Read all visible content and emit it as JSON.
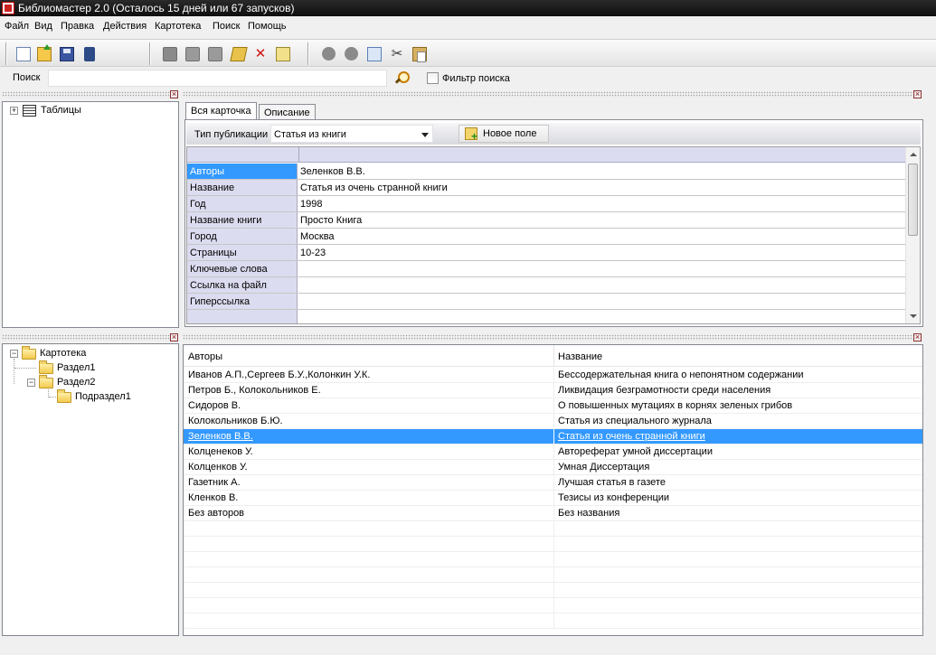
{
  "window": {
    "title": "Библиомастер 2.0 (Осталось 15 дней или 67 запусков)"
  },
  "menu": [
    "Файл",
    "Вид",
    "Правка",
    "Действия",
    "Картотека",
    "Поиск",
    "Помощь"
  ],
  "toolbar": {
    "icons": [
      "new-document-icon",
      "open-folder-icon",
      "save-icon",
      "export-icon",
      "grid-icon",
      "folder-gray-icon",
      "folder-gray-icon",
      "edit-icon",
      "delete-icon",
      "note-icon",
      "circle-icon",
      "circle-icon",
      "copy-icon",
      "cut-icon",
      "paste-icon"
    ]
  },
  "search": {
    "label": "Поиск",
    "value": "",
    "filter_label": "Фильтр поиска",
    "filter_checked": false
  },
  "tables_tree": {
    "root_label": "Таблицы"
  },
  "tabs": [
    "Вся карточка",
    "Описание"
  ],
  "card": {
    "pub_type_label": "Тип публикации",
    "pub_type_value": "Статья из книги",
    "new_field_label": "Новое поле",
    "rows": [
      {
        "key": "Авторы",
        "value": "Зеленков В.В."
      },
      {
        "key": "Название",
        "value": "Статья из очень странной книги"
      },
      {
        "key": "Год",
        "value": "1998"
      },
      {
        "key": "Название книги",
        "value": "Просто Книга"
      },
      {
        "key": "Город",
        "value": "Москва"
      },
      {
        "key": "Страницы",
        "value": "10-23"
      },
      {
        "key": "Ключевые слова",
        "value": ""
      },
      {
        "key": "Ссылка на файл",
        "value": ""
      },
      {
        "key": "Гиперссылка",
        "value": ""
      },
      {
        "key": "",
        "value": ""
      }
    ]
  },
  "catalog_tree": {
    "root": "Картотека",
    "section1": "Раздел1",
    "section2": "Раздел2",
    "subsection1": "Подраздел1"
  },
  "list": {
    "headers": [
      "Авторы",
      "Название"
    ],
    "rows": [
      {
        "authors": "Иванов А.П.,Сергеев Б.У.,Колонкин У.К.",
        "title": "Бессодержательная книга о непонятном содержании"
      },
      {
        "authors": "Петров Б., Колокольников Е.",
        "title": "Ликвидация безграмотности среди населения"
      },
      {
        "authors": "Сидоров В.",
        "title": "О повышенных мутациях в корнях зеленых грибов"
      },
      {
        "authors": "Колокольников Б.Ю.",
        "title": "Статья из специального журнала"
      },
      {
        "authors": "Зеленков В.В.",
        "title": "Статья из очень странной книги"
      },
      {
        "authors": "Колценеков У.",
        "title": "Автореферат умной диссертации"
      },
      {
        "authors": "Колценков У.",
        "title": "Умная Диссертация"
      },
      {
        "authors": "Газетник А.",
        "title": "Лучшая статья в газете"
      },
      {
        "authors": "Кленков В.",
        "title": "Тезисы из конференции"
      },
      {
        "authors": "Без авторов",
        "title": "Без названия"
      }
    ],
    "selected_index": 4
  },
  "colors": {
    "selection": "#3399ff",
    "card_key_bg": "#dcdcf0",
    "titlebar": "#1a1a1a"
  }
}
